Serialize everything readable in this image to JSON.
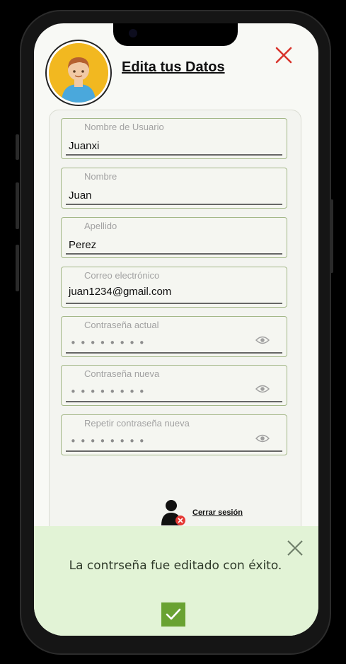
{
  "header": {
    "title": "Edita tus Datos"
  },
  "form": {
    "username": {
      "label": "Nombre de Usuario",
      "value": "Juanxi"
    },
    "first_name": {
      "label": "Nombre",
      "value": "Juan"
    },
    "last_name": {
      "label": "Apellido",
      "value": "Perez"
    },
    "email": {
      "label": "Correo electrónico",
      "value": "juan1234@gmail.com"
    },
    "current_password": {
      "label": "Contraseña actual",
      "mask": "••••••••"
    },
    "new_password": {
      "label": "Contraseña nueva",
      "mask": "••••••••"
    },
    "repeat_password": {
      "label": "Repetir contraseña nueva",
      "mask": "••••••••"
    }
  },
  "logout": {
    "label": "Cerrar sesión"
  },
  "toast": {
    "message": "La contrseña fue editado con éxito."
  },
  "colors": {
    "field_border": "#a3b787",
    "toast_bg": "#e2f3d6",
    "check_bg": "#69a232",
    "close_red": "#d8342c",
    "avatar_bg": "#f2b820"
  },
  "icons": {
    "close": "close-icon",
    "eye": "eye-icon",
    "logout": "user-logout-icon",
    "check": "checkmark-icon"
  }
}
